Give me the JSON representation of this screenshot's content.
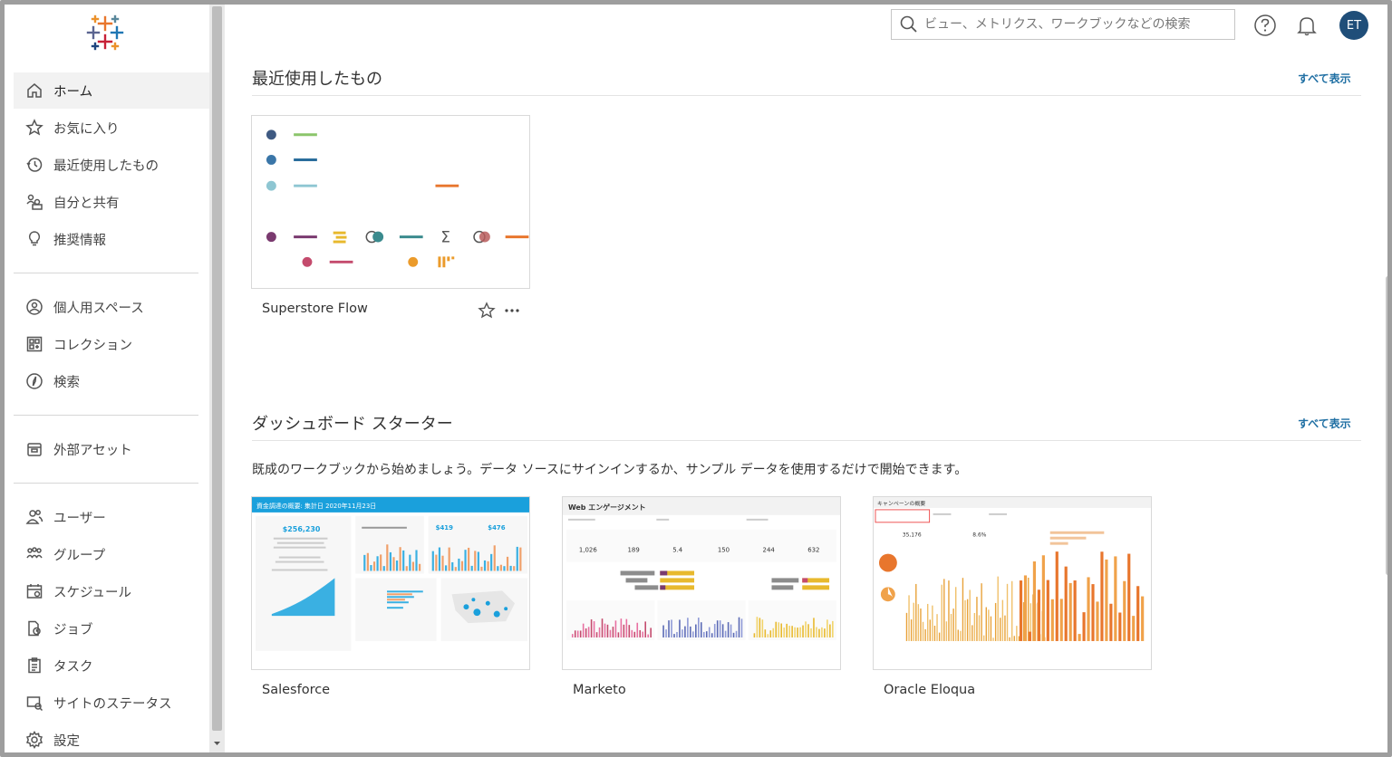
{
  "search": {
    "placeholder": "ビュー、メトリクス、ワークブックなどの検索"
  },
  "user": {
    "initials": "ET"
  },
  "nav": {
    "home": "ホーム",
    "favorites": "お気に入り",
    "recents": "最近使用したもの",
    "shared": "自分と共有",
    "recommendations": "推奨情報",
    "personal_space": "個人用スペース",
    "collections": "コレクション",
    "explore": "検索",
    "external_assets": "外部アセット",
    "users": "ユーザー",
    "groups": "グループ",
    "schedules": "スケジュール",
    "jobs": "ジョブ",
    "tasks": "タスク",
    "site_status": "サイトのステータス",
    "settings": "設定"
  },
  "recent": {
    "title": "最近使用したもの",
    "view_all": "すべて表示",
    "items": [
      {
        "name": "Superstore Flow"
      }
    ]
  },
  "starters": {
    "title": "ダッシュボード スターター",
    "view_all": "すべて表示",
    "description": "既成のワークブックから始めましょう。データ ソースにサインインするか、サンプル データを使用するだけで開始できます。",
    "items": [
      {
        "name": "Salesforce",
        "thumb_title": "資金調達の概要: 集計日 2020年11月23日",
        "kpis": [
          "$256,230",
          "$419",
          "$476"
        ]
      },
      {
        "name": "Marketo",
        "thumb_title": "Web エンゲージメント",
        "kpis": [
          "1,026",
          "189",
          "5.4",
          "150",
          "244",
          "632"
        ]
      },
      {
        "name": "Oracle Eloqua",
        "thumb_title": "キャンペーンの概要",
        "kpis": [
          "35,176",
          "8.6%"
        ]
      }
    ]
  },
  "colors": {
    "accent": "#1f6fa3",
    "avatar": "#1f4e79",
    "salesforce_header": "#1aa0dc"
  }
}
